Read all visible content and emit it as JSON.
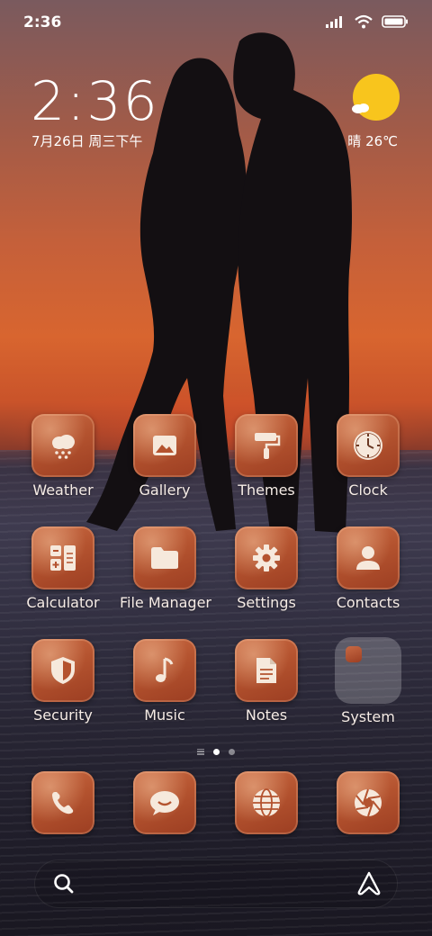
{
  "status_bar": {
    "time": "2:36"
  },
  "clock_widget": {
    "time": "2:36",
    "date": "7月26日 周三下午"
  },
  "weather_widget": {
    "text": "晴 26℃"
  },
  "apps": [
    {
      "label": "Weather",
      "icon": "cloud-snow-icon"
    },
    {
      "label": "Gallery",
      "icon": "image-icon"
    },
    {
      "label": "Themes",
      "icon": "paint-roller-icon"
    },
    {
      "label": "Clock",
      "icon": "clock-icon"
    },
    {
      "label": "Calculator",
      "icon": "calculator-icon"
    },
    {
      "label": "File Manager",
      "icon": "folder-icon"
    },
    {
      "label": "Settings",
      "icon": "gear-icon"
    },
    {
      "label": "Contacts",
      "icon": "person-icon"
    },
    {
      "label": "Security",
      "icon": "shield-icon"
    },
    {
      "label": "Music",
      "icon": "music-note-icon"
    },
    {
      "label": "Notes",
      "icon": "note-icon"
    },
    {
      "label": "System",
      "icon": "folder-icon"
    }
  ],
  "dock": [
    {
      "icon": "phone-icon"
    },
    {
      "icon": "chat-bubble-icon"
    },
    {
      "icon": "globe-icon"
    },
    {
      "icon": "camera-aperture-icon"
    }
  ],
  "page_indicator": {
    "pages": 2,
    "active": 1
  },
  "colors": {
    "icon_bg": "#b4532f",
    "glyph": "#f6e9dc",
    "sun": "#f8c51d"
  }
}
